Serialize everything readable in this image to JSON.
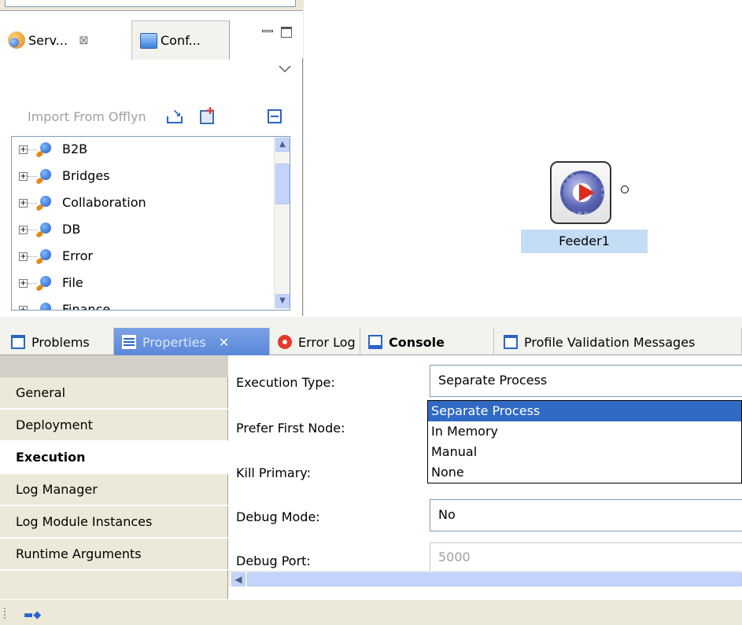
{
  "services_view": {
    "tab_services": "Serv...",
    "tab_config": "Conf...",
    "import_label": "Import From Offlyn",
    "tree_items": [
      "B2B",
      "Bridges",
      "Collaboration",
      "DB",
      "Error",
      "File",
      "Finance"
    ]
  },
  "canvas": {
    "component_label": "Feeder1"
  },
  "bottom_tabs": {
    "problems": "Problems",
    "properties": "Properties",
    "error_log": "Error Log",
    "console": "Console",
    "profile_validation": "Profile Validation Messages"
  },
  "properties": {
    "sidebar": [
      "General",
      "Deployment",
      "Execution",
      "Log Manager",
      "Log Module Instances",
      "Runtime Arguments"
    ],
    "active_section": "Execution",
    "fields": {
      "execution_type_label": "Execution Type:",
      "execution_type_value": "Separate Process",
      "prefer_first_node_label": "Prefer First Node:",
      "kill_primary_label": "Kill Primary:",
      "debug_mode_label": "Debug Mode:",
      "debug_mode_value": "No",
      "debug_port_label": "Debug Port:",
      "debug_port_value": "5000"
    },
    "execution_type_options": [
      "Separate Process",
      "In Memory",
      "Manual",
      "None"
    ],
    "selected_option": "Separate Process"
  },
  "colors": {
    "selection": "#316ac5",
    "active_tab": "#5a87d8",
    "label_highlight": "#c5dcf5"
  }
}
